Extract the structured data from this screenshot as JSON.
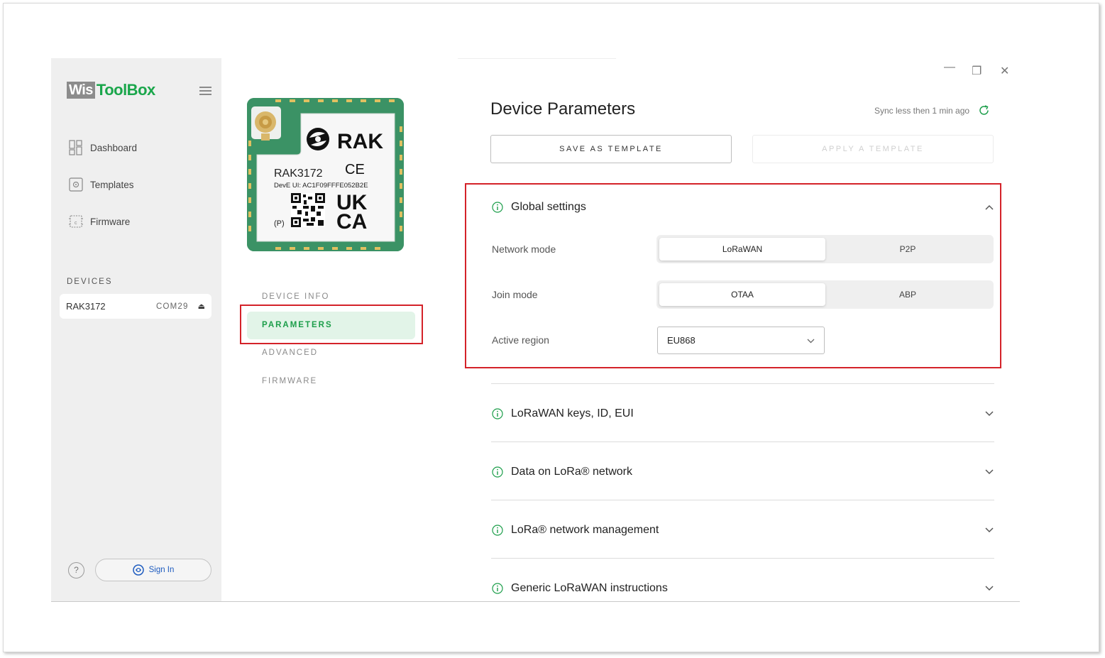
{
  "app": {
    "logo_part1": "Wis",
    "logo_part2": "ToolBox"
  },
  "sidebar": {
    "items": [
      {
        "label": "Dashboard",
        "icon": "dashboard-icon"
      },
      {
        "label": "Templates",
        "icon": "templates-icon"
      },
      {
        "label": "Firmware",
        "icon": "firmware-icon"
      }
    ],
    "devices_heading": "DEVICES",
    "device": {
      "name": "RAK3172",
      "port": "COM29",
      "eject": "⏏"
    },
    "help_label": "?",
    "signin_label": "Sign In"
  },
  "device_image": {
    "brand": "RAK",
    "model": "RAK3172",
    "deveui": "DevE UI: AC1F09FFFE052B2E",
    "ce": "CE",
    "ukca1": "UK",
    "ukca2": "CA",
    "p": "(P)"
  },
  "midnav": {
    "items": [
      "DEVICE INFO",
      "PARAMETERS",
      "ADVANCED",
      "FIRMWARE"
    ],
    "active": "PARAMETERS"
  },
  "window": {
    "minimize": "—",
    "restore": "❐",
    "close": "✕"
  },
  "main": {
    "title": "Device Parameters",
    "sync_text": "Sync less then 1 min ago",
    "save_template": "SAVE AS TEMPLATE",
    "apply_template": "APPLY A TEMPLATE",
    "global": {
      "title": "Global settings",
      "network_mode_label": "Network mode",
      "network_mode_options": [
        "LoRaWAN",
        "P2P"
      ],
      "network_mode_selected": "LoRaWAN",
      "join_mode_label": "Join mode",
      "join_mode_options": [
        "OTAA",
        "ABP"
      ],
      "join_mode_selected": "OTAA",
      "active_region_label": "Active region",
      "active_region_value": "EU868"
    },
    "sections": [
      "LoRaWAN keys, ID, EUI",
      "Data on LoRa® network",
      "LoRa® network management",
      "Generic LoRaWAN instructions"
    ]
  },
  "colors": {
    "accent_green": "#1c9e4a",
    "highlight_red": "#d42229",
    "board_green": "#3b9265"
  }
}
